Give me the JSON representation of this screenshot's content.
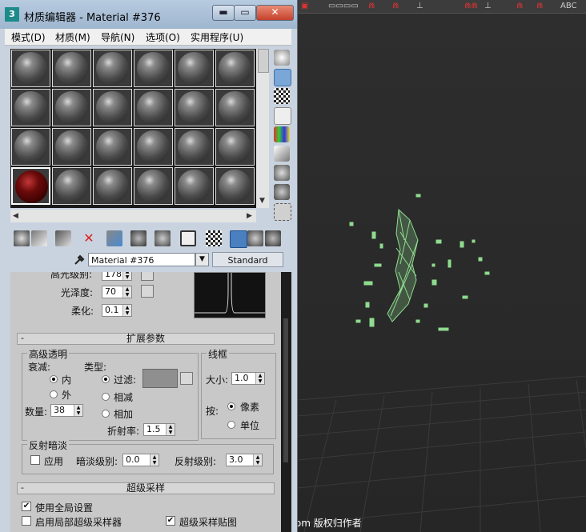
{
  "window": {
    "title": "材质编辑器 - Material #376",
    "app_icon": "3",
    "min": "▬",
    "max": "▭",
    "close": "✕"
  },
  "menu": [
    "模式(D)",
    "材质(M)",
    "导航(N)",
    "选项(O)",
    "实用程序(U)"
  ],
  "material": {
    "name": "Material #376",
    "type_button": "Standard"
  },
  "basic_params": {
    "specular_level_label": "高光级别:",
    "specular_level": "178",
    "glossiness_label": "光泽度:",
    "glossiness": "70",
    "soften_label": "柔化:",
    "soften": "0.1"
  },
  "extended": {
    "title": "扩展参数",
    "collapse": "-",
    "advanced_transparency": {
      "title": "高级透明",
      "falloff_label": "衰减:",
      "falloff_in": "内",
      "falloff_out": "外",
      "falloff_selected": "in",
      "type_label": "类型:",
      "type_filter": "过滤:",
      "type_subtractive": "相减",
      "type_additive": "相加",
      "type_selected": "filter",
      "amount_label": "数量:",
      "amount": "38",
      "ior_label": "折射率:",
      "ior": "1.5"
    },
    "wire": {
      "title": "线框",
      "size_label": "大小:",
      "size": "1.0",
      "in_label": "按:",
      "pixels": "像素",
      "units": "单位",
      "selected": "pixels"
    },
    "reflection_dimming": {
      "title": "反射暗淡",
      "apply": "应用",
      "apply_checked": false,
      "dim_level_label": "暗淡级别:",
      "dim_level": "0.0",
      "refl_level_label": "反射级别:",
      "refl_level": "3.0"
    }
  },
  "supersampling": {
    "title": "超级采样",
    "collapse": "-",
    "use_global": "使用全局设置",
    "use_global_checked": true,
    "enable_local": "启用局部超级采样器",
    "enable_local_checked": false,
    "supersample_maps": "超级采样贴图",
    "supersample_maps_checked": true
  },
  "watermark": "出自www.cgjoy.com 版权归作者",
  "colors": {
    "wireframe": "#8fdb8f",
    "window_bg": "#c9d3df",
    "viewport": "#2a2a2a"
  }
}
